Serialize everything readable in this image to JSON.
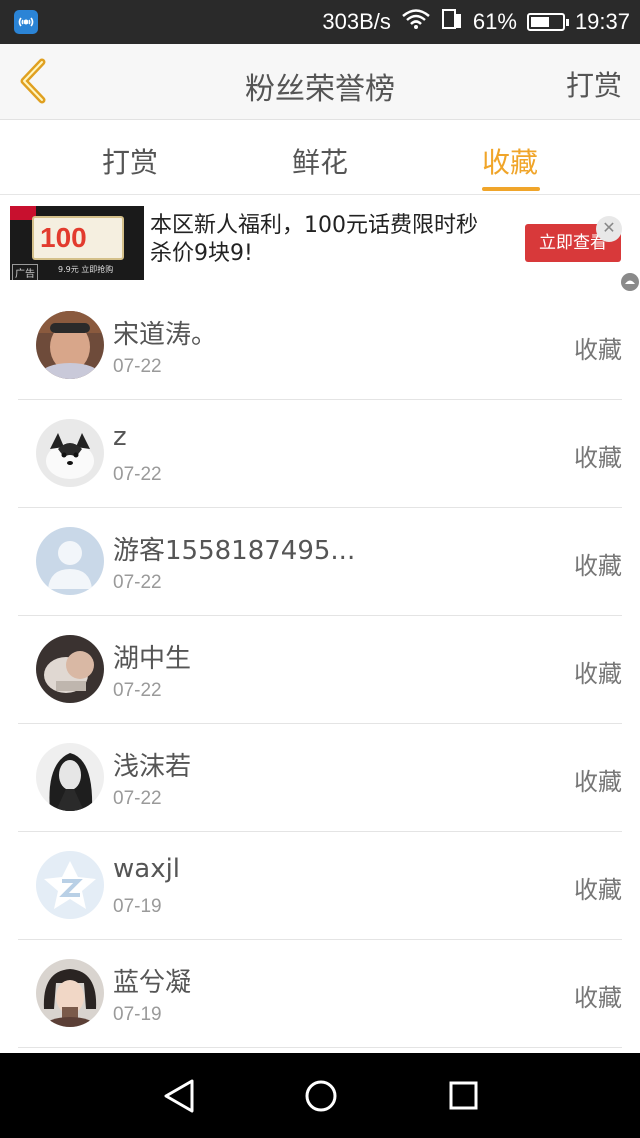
{
  "status_bar": {
    "network_speed": "303B/s",
    "battery_percent": "61%",
    "battery_level": 0.61,
    "time": "19:37"
  },
  "header": {
    "title": "粉丝荣誉榜",
    "right_action": "打赏"
  },
  "tabs": [
    {
      "label": "打赏",
      "active": false
    },
    {
      "label": "鲜花",
      "active": false
    },
    {
      "label": "收藏",
      "active": true
    }
  ],
  "ad": {
    "image_number": "100",
    "image_tag": "广告",
    "image_subtext": "9.9元 立即抢购",
    "text": "本区新人福利，100元话费限时秒杀价9块9!",
    "button": "立即查看"
  },
  "list": [
    {
      "name": "宋道涛。",
      "date": "07-22",
      "action": "收藏",
      "avatar": "photo-man"
    },
    {
      "name": "z",
      "date": "07-22",
      "action": "收藏",
      "avatar": "photo-dog"
    },
    {
      "name": "游客1558187495...",
      "date": "07-22",
      "action": "收藏",
      "avatar": "default-user"
    },
    {
      "name": "湖中生",
      "date": "07-22",
      "action": "收藏",
      "avatar": "photo-baby"
    },
    {
      "name": "浅沫若",
      "date": "07-22",
      "action": "收藏",
      "avatar": "photo-woman"
    },
    {
      "name": "waxjl",
      "date": "07-19",
      "action": "收藏",
      "avatar": "qq-logo"
    },
    {
      "name": "蓝兮凝",
      "date": "07-19",
      "action": "收藏",
      "avatar": "photo-girl"
    }
  ],
  "colors": {
    "accent": "#f0a52a",
    "ad_button": "#d8393a",
    "status_bar": "#2a2a2a"
  }
}
